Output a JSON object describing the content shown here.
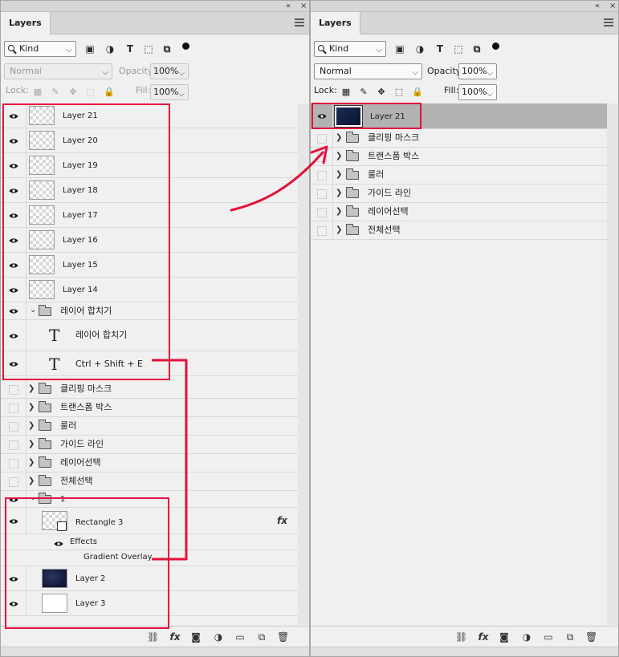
{
  "left_panel": {
    "tab_label": "Layers",
    "collapse_glyph": "«",
    "close_glyph": "×",
    "filter": {
      "kind_label": "Kind"
    },
    "blend_mode": "Normal",
    "opacity_label": "Opacity:",
    "opacity_value": "100%",
    "lock_label": "Lock:",
    "fill_label": "Fill:",
    "fill_value": "100%",
    "layers": [
      {
        "name": "Layer 21",
        "visible": true,
        "thumb": "checker"
      },
      {
        "name": "Layer 20",
        "visible": true,
        "thumb": "checker"
      },
      {
        "name": "Layer 19",
        "visible": true,
        "thumb": "checker"
      },
      {
        "name": "Layer 18",
        "visible": true,
        "thumb": "checker"
      },
      {
        "name": "Layer 17",
        "visible": true,
        "thumb": "checker"
      },
      {
        "name": "Layer 16",
        "visible": true,
        "thumb": "checker"
      },
      {
        "name": "Layer 15",
        "visible": true,
        "thumb": "checker"
      },
      {
        "name": "Layer 14",
        "visible": true,
        "thumb": "checker"
      }
    ],
    "merge_group": {
      "name": "레이어 합치기",
      "children": [
        {
          "name": "레이어 합치기",
          "type": "text"
        },
        {
          "name": "Ctrl + Shift + E",
          "type": "text"
        }
      ]
    },
    "groups": [
      "클리핑 마스크",
      "트랜스폼 박스",
      "룰러",
      "가이드 라인",
      "레이어선택",
      "전체선택"
    ],
    "group_1": {
      "name": "1",
      "rect_layer": "Rectangle 3",
      "fx_glyph": "fx",
      "effects_label": "Effects",
      "effect_name": "Gradient Overlay",
      "layers_after": [
        {
          "name": "Layer 2",
          "thumb": "navy"
        },
        {
          "name": "Layer 3",
          "thumb": "white"
        }
      ]
    },
    "footer_icons": [
      "link-icon",
      "fx-icon",
      "mask-icon",
      "adjustment-icon",
      "folder-icon",
      "new-layer-icon",
      "trash-icon"
    ]
  },
  "right_panel": {
    "tab_label": "Layers",
    "collapse_glyph": "«",
    "close_glyph": "×",
    "filter": {
      "kind_label": "Kind"
    },
    "blend_mode": "Normal",
    "opacity_label": "Opacity:",
    "opacity_value": "100%",
    "lock_label": "Lock:",
    "fill_label": "Fill:",
    "fill_value": "100%",
    "merged_layer": {
      "name": "Layer 21",
      "selected": true
    },
    "groups": [
      "클리핑 마스크",
      "트랜스폼 박스",
      "룰러",
      "가이드 라인",
      "레이어선택",
      "전체선택"
    ],
    "footer_icons": [
      "link-icon",
      "fx-icon",
      "mask-icon",
      "adjustment-icon",
      "folder-icon",
      "new-layer-icon",
      "trash-icon"
    ]
  },
  "colors": {
    "highlight": "#e4103c",
    "panel_bg": "#f0f0f0",
    "selected_row": "#b2b2b2"
  }
}
